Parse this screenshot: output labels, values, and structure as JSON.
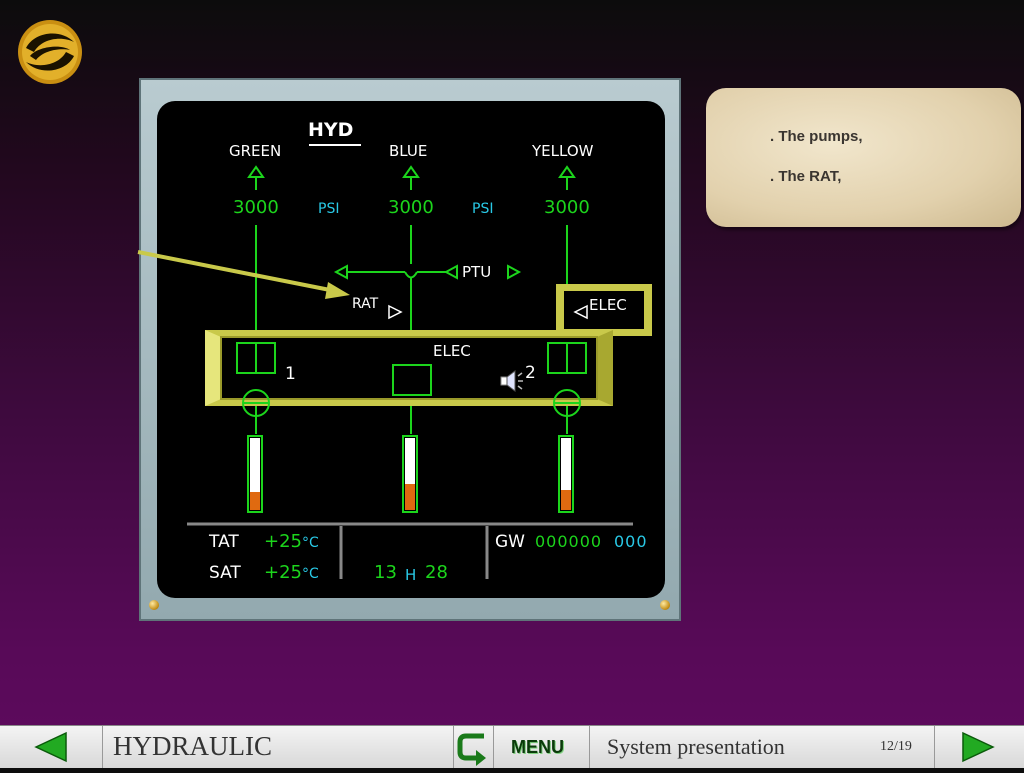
{
  "logo": {
    "icon": "company-logo-icon",
    "color": "#d7a21a"
  },
  "display": {
    "title": "HYD",
    "systems": [
      {
        "label": "GREEN",
        "pressure": "3000"
      },
      {
        "label": "BLUE",
        "pressure": "3000"
      },
      {
        "label": "YELLOW",
        "pressure": "3000"
      }
    ],
    "psi_labels": [
      "PSI",
      "PSI"
    ],
    "ptu_label": "PTU",
    "rat_label": "RAT",
    "elec_label_pump": "ELEC",
    "elec_label_yellow": "ELEC",
    "pump_numbers": [
      "1",
      "2"
    ],
    "tat_label": "TAT",
    "tat_value": "+25",
    "tat_unit": "°C",
    "sat_label": "SAT",
    "sat_value": "+25",
    "sat_unit": "°C",
    "time_hours": "13",
    "time_sep": "H",
    "time_minutes": "28",
    "gw_label": "GW",
    "gw_value": "000000",
    "gw_suffix": "000"
  },
  "note": {
    "lines": [
      ". The pumps,",
      ". The RAT,"
    ]
  },
  "navbar": {
    "prev_icon": "left-arrow-icon",
    "section_title": "HYDRAULIC",
    "return_icon": "return-arrow-icon",
    "menu_label": "MENU",
    "subtitle": "System presentation",
    "page": "12/19",
    "next_icon": "right-arrow-icon"
  },
  "colors": {
    "display_green": "#1cd51c",
    "display_cyan": "#29c9e6",
    "highlight": "#d8d860",
    "nav_arrow": "#22aa22"
  }
}
